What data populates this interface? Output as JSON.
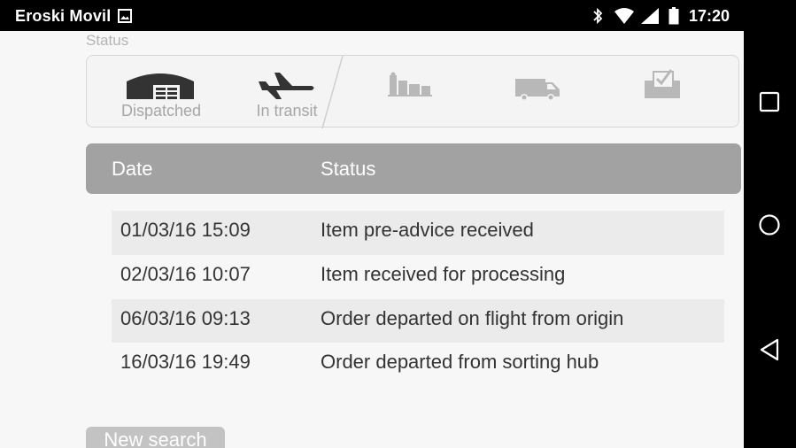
{
  "statusbar": {
    "carrier": "Eroski Movil",
    "time": "17:20",
    "icons": [
      "image-icon",
      "bluetooth-icon",
      "wifi-icon",
      "signal-icon",
      "battery-icon"
    ]
  },
  "navbar": {
    "icons": [
      "recents-square-icon",
      "home-circle-icon",
      "back-triangle-icon"
    ]
  },
  "tracker": {
    "section_label": "Status",
    "steps": [
      {
        "label": "Dispatched",
        "icon": "warehouse-icon",
        "active": true
      },
      {
        "label": "In transit",
        "icon": "airplane-icon",
        "active": true
      },
      {
        "label": "",
        "icon": "parcels-icon",
        "active": false
      },
      {
        "label": "",
        "icon": "delivery-van-icon",
        "active": false
      },
      {
        "label": "",
        "icon": "mailbox-delivered-icon",
        "active": false
      }
    ]
  },
  "table": {
    "headers": {
      "date": "Date",
      "status": "Status"
    },
    "rows": [
      {
        "date": "01/03/16 15:09",
        "status": "Item pre-advice received"
      },
      {
        "date": "02/03/16 10:07",
        "status": "Item received for processing"
      },
      {
        "date": "06/03/16 09:13",
        "status": "Order departed on flight from origin"
      },
      {
        "date": "16/03/16 19:49",
        "status": "Order departed from sorting hub"
      }
    ]
  },
  "actions": {
    "new_search_label": "New search"
  },
  "colors": {
    "header_bar": "#a2a2a2",
    "active_icon": "#333333",
    "inactive_icon": "#b8b8b8",
    "row_shade": "#ebebeb"
  }
}
